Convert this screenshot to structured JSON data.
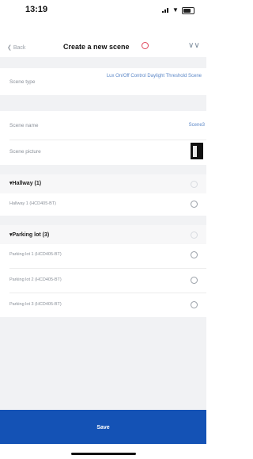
{
  "status_bar": {
    "time": "13:19"
  },
  "header": {
    "back_label": "Back",
    "title": "Create a new scene"
  },
  "scene_type": {
    "label": "Scene type",
    "value": "Lux On/Off Control Daylight Threshold Scene"
  },
  "scene_name": {
    "label": "Scene name",
    "value": "Scene3"
  },
  "scene_picture": {
    "label": "Scene picture"
  },
  "groups": [
    {
      "title": "▾Hallway (1)",
      "devices": [
        "Hallway 1 (HCD405-BT)"
      ]
    },
    {
      "title": "▾Parking lot (3)",
      "devices": [
        "Parking lot 1 (HCD405-BT)",
        "Parking lot 2 (HCD405-BT)",
        "Parking lot 3 (HCD405-BT)"
      ]
    }
  ],
  "footer": {
    "save_label": "Save"
  },
  "colors": {
    "accent": "#1452b5",
    "link": "#5b87c7",
    "info": "#e0455a"
  }
}
